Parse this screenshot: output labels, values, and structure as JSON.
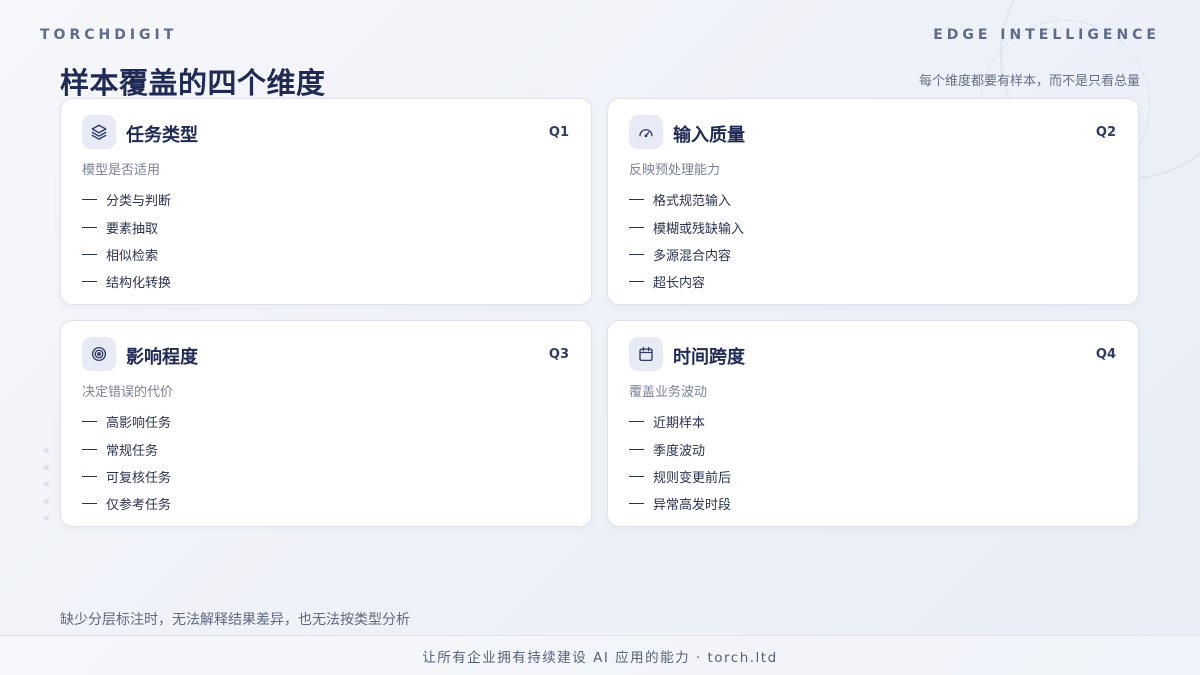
{
  "header": {
    "brand_left": "TORCHDIGIT",
    "brand_right": "EDGE INTELLIGENCE"
  },
  "title": "样本覆盖的四个维度",
  "subtitle": "每个维度都要有样本，而不是只看总量",
  "accent_color": "#1f2a55",
  "cards": [
    {
      "icon": "layers-icon",
      "title": "任务类型",
      "tag": "Q1",
      "desc": "模型是否适用",
      "items": [
        "分类与判断",
        "要素抽取",
        "相似检索",
        "结构化转换"
      ]
    },
    {
      "icon": "gauge-icon",
      "title": "输入质量",
      "tag": "Q2",
      "desc": "反映预处理能力",
      "items": [
        "格式规范输入",
        "模糊或残缺输入",
        "多源混合内容",
        "超长内容"
      ]
    },
    {
      "icon": "target-icon",
      "title": "影响程度",
      "tag": "Q3",
      "desc": "决定错误的代价",
      "items": [
        "高影响任务",
        "常规任务",
        "可复核任务",
        "仅参考任务"
      ]
    },
    {
      "icon": "calendar-icon",
      "title": "时间跨度",
      "tag": "Q4",
      "desc": "覆盖业务波动",
      "items": [
        "近期样本",
        "季度波动",
        "规则变更前后",
        "异常高发时段"
      ]
    }
  ],
  "footnote": "缺少分层标注时，无法解释结果差异，也无法按类型分析",
  "bottom_bar": "让所有企业拥有持续建设 AI 应用的能力 · torch.ltd"
}
